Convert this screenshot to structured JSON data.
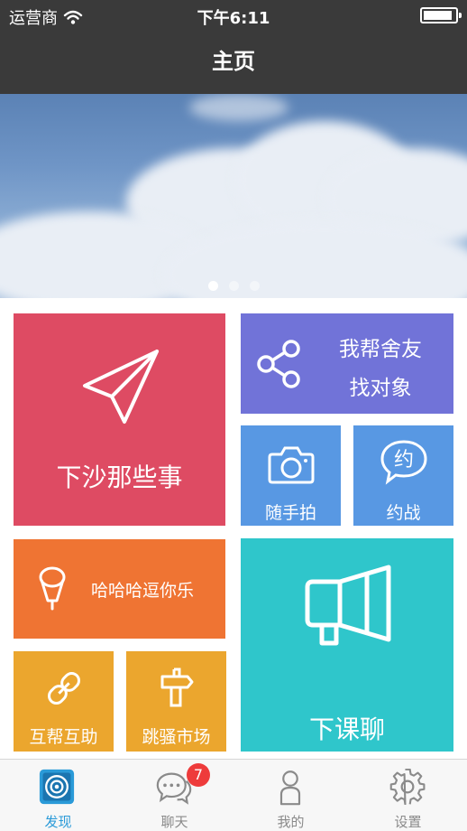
{
  "status_bar": {
    "carrier": "运营商",
    "time": "下午6:11",
    "battery_level": 0.9
  },
  "nav": {
    "title": "主页"
  },
  "banner": {
    "page_count": 3,
    "active_page": 1
  },
  "tiles": {
    "xiasha": {
      "label": "下沙那些事",
      "icon": "paper-plane-icon",
      "color": "#de4b63"
    },
    "roommate": {
      "line1": "我帮舍友",
      "line2": "找对象",
      "icon": "share-icon",
      "color": "#7173d8"
    },
    "photo": {
      "label": "随手拍",
      "icon": "camera-icon",
      "color": "#5898e3"
    },
    "yuezhan": {
      "label": "约战",
      "icon": "yue-chat-icon",
      "color": "#5898e3"
    },
    "funny": {
      "label": "哈哈哈逗你乐",
      "icon": "microphone-icon",
      "color": "#ef7433"
    },
    "chat": {
      "label": "下课聊",
      "icon": "megaphone-icon",
      "color": "#2fc6cb"
    },
    "help": {
      "label": "互帮互助",
      "icon": "link-icon",
      "color": "#eba62e"
    },
    "market": {
      "label": "跳骚市场",
      "icon": "signpost-icon",
      "color": "#eba62e"
    }
  },
  "tabbar": {
    "discover": {
      "label": "发现",
      "icon": "discover-icon",
      "active": true
    },
    "chat": {
      "label": "聊天",
      "icon": "chat-bubbles-icon",
      "badge": "7"
    },
    "mine": {
      "label": "我的",
      "icon": "user-icon"
    },
    "settings": {
      "label": "设置",
      "icon": "gear-icon"
    }
  },
  "colors": {
    "bar_dark": "#3a3a3a",
    "active_tab": "#2a9ad8",
    "badge": "#ee3b3b"
  }
}
